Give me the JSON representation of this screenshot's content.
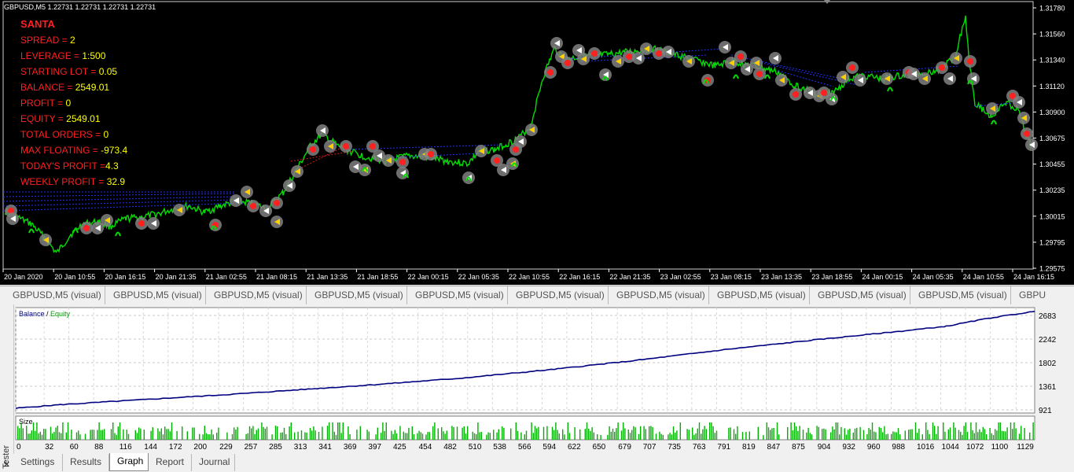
{
  "chart_header": "GBPUSD,M5  1.22731 1.22731 1.22731 1.22731",
  "ea_panel": {
    "name": "SANTA",
    "rows": [
      {
        "label": "SPREAD = ",
        "value": "2"
      },
      {
        "label": "LEVERAGE = ",
        "value": "1:500"
      },
      {
        "label": "STARTING LOT = ",
        "value": "0.05"
      },
      {
        "label": "BALANCE = ",
        "value": "2549.01"
      },
      {
        "label": "PROFIT = ",
        "value": "0"
      },
      {
        "label": "EQUITY = ",
        "value": "2549.01"
      },
      {
        "label": "TOTAL ORDERS = ",
        "value": "0"
      },
      {
        "label": "MAX FLOATING = ",
        "value": "-973.4"
      },
      {
        "label": "TODAY'S PROFIT =",
        "value": "4.3"
      },
      {
        "label": "WEEKLY PROFIT = ",
        "value": "32.9"
      }
    ]
  },
  "price_axis": [
    "1.31780",
    "1.31560",
    "1.31340",
    "1.31120",
    "1.30900",
    "1.30675",
    "1.30455",
    "1.30235",
    "1.30015",
    "1.29795",
    "1.29575"
  ],
  "time_axis": [
    "20 Jan 2020",
    "20 Jan 10:55",
    "20 Jan 16:15",
    "20 Jan 21:35",
    "21 Jan 02:55",
    "21 Jan 08:15",
    "21 Jan 13:35",
    "21 Jan 18:55",
    "22 Jan 00:15",
    "22 Jan 05:35",
    "22 Jan 10:55",
    "22 Jan 16:15",
    "22 Jan 21:35",
    "23 Jan 02:55",
    "23 Jan 08:15",
    "23 Jan 13:35",
    "23 Jan 18:55",
    "24 Jan 00:15",
    "24 Jan 05:35",
    "24 Jan 10:55",
    "24 Jan 16:15"
  ],
  "chart_tabs": [
    "GBPUSD,M5 (visual)",
    "GBPUSD,M5 (visual)",
    "GBPUSD,M5 (visual)",
    "GBPUSD,M5 (visual)",
    "GBPUSD,M5 (visual)",
    "GBPUSD,M5 (visual)",
    "GBPUSD,M5 (visual)",
    "GBPUSD,M5 (visual)",
    "GBPUSD,M5 (visual)",
    "GBPUSD,M5 (visual)",
    "GBPU"
  ],
  "tester": {
    "side_label": "Tester",
    "close_glyph": "✕",
    "tabs": [
      "Settings",
      "Results",
      "Graph",
      "Report",
      "Journal"
    ],
    "active_tab": "Graph"
  },
  "colors": {
    "bull": "#00e000",
    "axis": "#ffffff",
    "panel_label": "#ff2020",
    "panel_value": "#ffff00",
    "balance": "#000080",
    "equity": "#00a000",
    "size_bar": "#00b000"
  },
  "chart_data": {
    "type": "line",
    "legend": [
      "Balance",
      "Equity"
    ],
    "legend_sep": " / ",
    "y_ticks": [
      "2683",
      "2242",
      "1802",
      "1361",
      "921"
    ],
    "ylim": [
      921,
      2683
    ],
    "x_ticks": [
      "0",
      "32",
      "60",
      "88",
      "116",
      "144",
      "172",
      "200",
      "229",
      "257",
      "285",
      "313",
      "341",
      "369",
      "397",
      "425",
      "454",
      "482",
      "510",
      "538",
      "566",
      "594",
      "622",
      "650",
      "679",
      "707",
      "735",
      "763",
      "791",
      "819",
      "847",
      "875",
      "904",
      "932",
      "960",
      "988",
      "1016",
      "1044",
      "1072",
      "1100",
      "1129"
    ],
    "xlim": [
      0,
      1150
    ],
    "series": [
      {
        "name": "Balance",
        "x": [
          0,
          50,
          150,
          250,
          340,
          400,
          500,
          600,
          700,
          800,
          850,
          900,
          1000,
          1050,
          1100,
          1150
        ],
        "values": [
          1000,
          1060,
          1150,
          1240,
          1330,
          1390,
          1500,
          1640,
          1800,
          1980,
          2060,
          2140,
          2290,
          2370,
          2510,
          2620
        ]
      }
    ],
    "size_label": "Size"
  }
}
